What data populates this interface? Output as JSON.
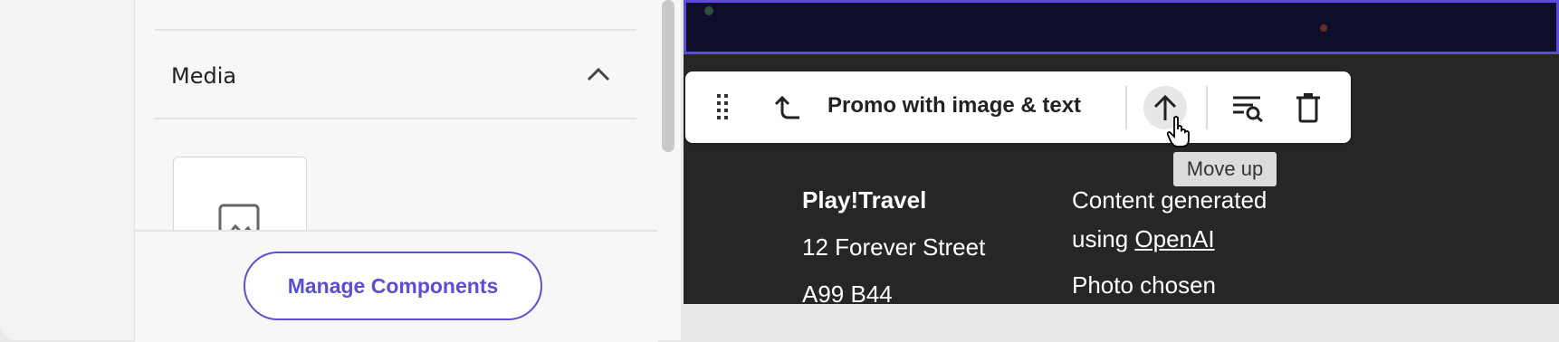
{
  "sidebar": {
    "media_section_title": "Media",
    "manage_components_label": "Manage Components"
  },
  "toolbar": {
    "component_label": "Promo with image & text",
    "move_up_tooltip": "Move up"
  },
  "footer": {
    "brand": "Play!Travel",
    "address_line1": "12 Forever Street",
    "address_line2": "A99 B44",
    "content_generated_prefix": "Content generated",
    "using_prefix": "using ",
    "openai_link": "OpenAI",
    "photo_chosen": "Photo chosen"
  },
  "colors": {
    "accent": "#5b4fd1",
    "preview_bg": "#262626"
  },
  "icons": [
    "chevron-up-icon",
    "image-placeholder-icon",
    "drag-handle-icon",
    "select-parent-icon",
    "arrow-up-icon",
    "search-list-icon",
    "trash-icon",
    "hand-cursor-icon"
  ]
}
